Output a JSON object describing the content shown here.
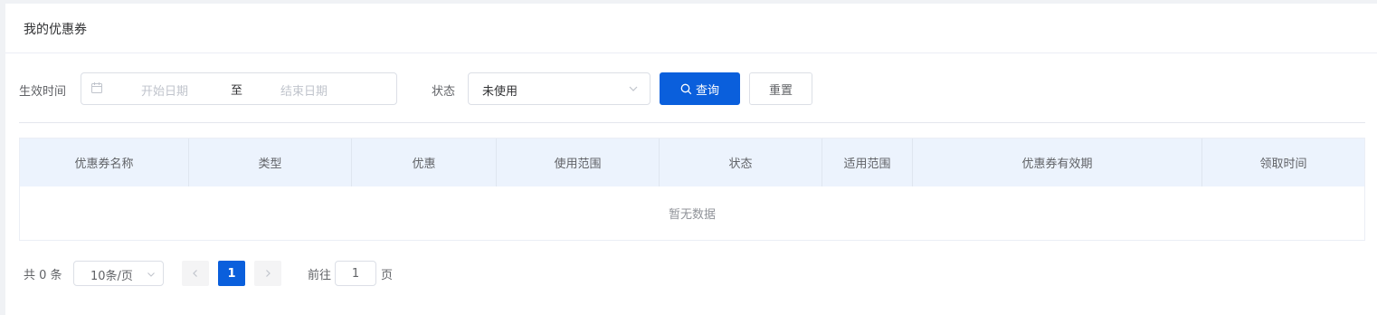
{
  "header": {
    "title": "我的优惠券"
  },
  "filters": {
    "date_label": "生效时间",
    "start_placeholder": "开始日期",
    "separator": "至",
    "end_placeholder": "结束日期",
    "status_label": "状态",
    "status_value": "未使用",
    "search_label": "查询",
    "reset_label": "重置"
  },
  "table": {
    "columns": [
      "优惠券名称",
      "类型",
      "优惠",
      "使用范围",
      "状态",
      "适用范围",
      "优惠券有效期",
      "领取时间"
    ],
    "empty_text": "暂无数据"
  },
  "pagination": {
    "total_label": "共 0 条",
    "page_size": "10条/页",
    "current_page": "1",
    "goto_label": "前往",
    "goto_value": "1",
    "page_suffix": "页"
  },
  "colors": {
    "primary": "#0a5fdc",
    "header_bg": "#ecf3fd"
  },
  "icons": {
    "date": "calendar-icon",
    "search": "search-icon",
    "dropdown": "chevron-down-icon",
    "prev": "chevron-left-icon",
    "next": "chevron-right-icon"
  }
}
